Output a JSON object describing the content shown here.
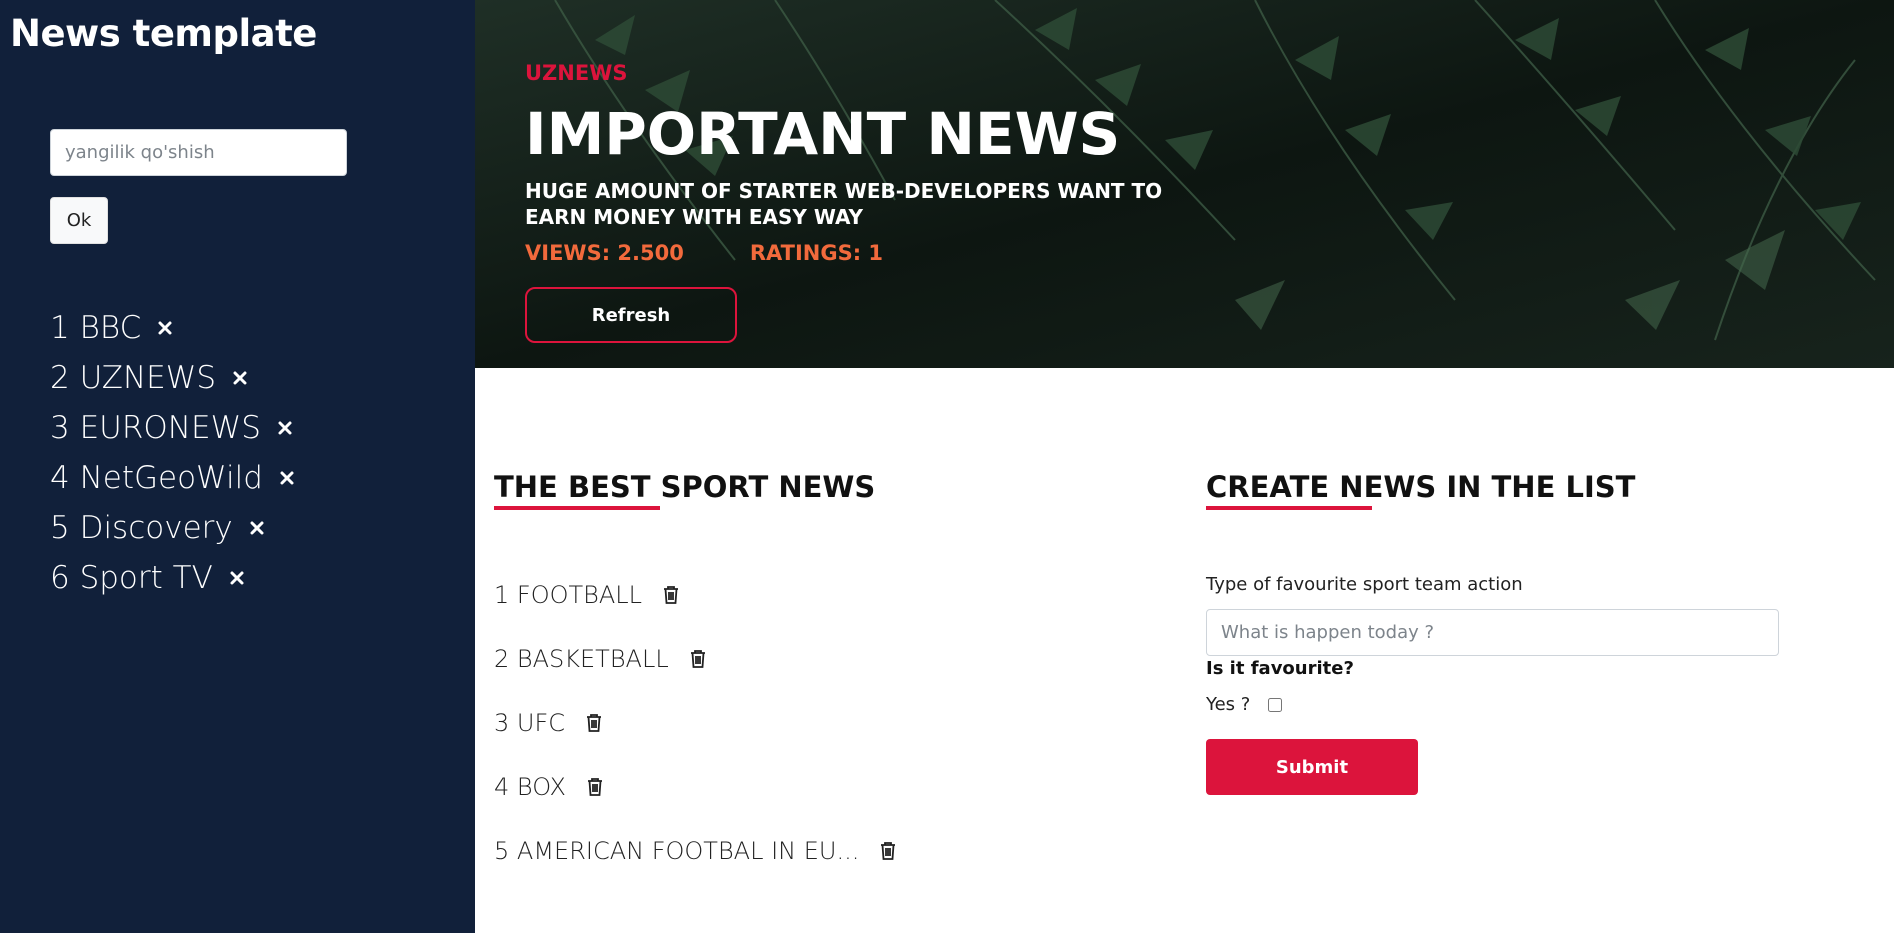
{
  "sidebar": {
    "title": "News template",
    "input_placeholder": "yangilik qo'shish",
    "ok_label": "Ok",
    "items": [
      {
        "label": "1 BBC",
        "icon": "close-icon"
      },
      {
        "label": "2 UZNEWS",
        "icon": "close-icon"
      },
      {
        "label": "3 EURONEWS",
        "icon": "close-icon"
      },
      {
        "label": "4 NetGeoWild",
        "icon": "close-icon"
      },
      {
        "label": "5 Discovery",
        "icon": "close-icon"
      },
      {
        "label": "6 Sport TV",
        "icon": "close-icon"
      }
    ]
  },
  "hero": {
    "brand": "UZNEWS",
    "title": "IMPORTANT NEWS",
    "subtitle": "HUGE AMOUNT OF STARTER WEB-DEVELOPERS WANT TO EARN MONEY WITH EASY WAY",
    "views": "VIEWS: 2.500",
    "ratings": "RATINGS: 1",
    "refresh_label": "Refresh"
  },
  "sport": {
    "title": "THE BEST SPORT NEWS",
    "items": [
      {
        "label": "1 FOOTBALL",
        "icon": "trash-icon"
      },
      {
        "label": "2 BASKETBALL",
        "icon": "trash-icon"
      },
      {
        "label": "3 UFC",
        "icon": "trash-icon"
      },
      {
        "label": "4 BOX",
        "icon": "trash-icon"
      },
      {
        "label": "5 AMERICAN FOOTBAL IN EU...",
        "icon": "trash-icon"
      }
    ]
  },
  "create": {
    "title": "CREATE NEWS IN THE LIST",
    "input_label": "Type of favourite sport team action",
    "input_placeholder": "What is happen today ?",
    "fav_question": "Is it favourite?",
    "yes_label": "Yes ?",
    "yes_checked": false,
    "submit_label": "Submit"
  },
  "colors": {
    "sidebar_bg": "#11203a",
    "accent": "#dc143c",
    "stats": "#f26a3c"
  }
}
